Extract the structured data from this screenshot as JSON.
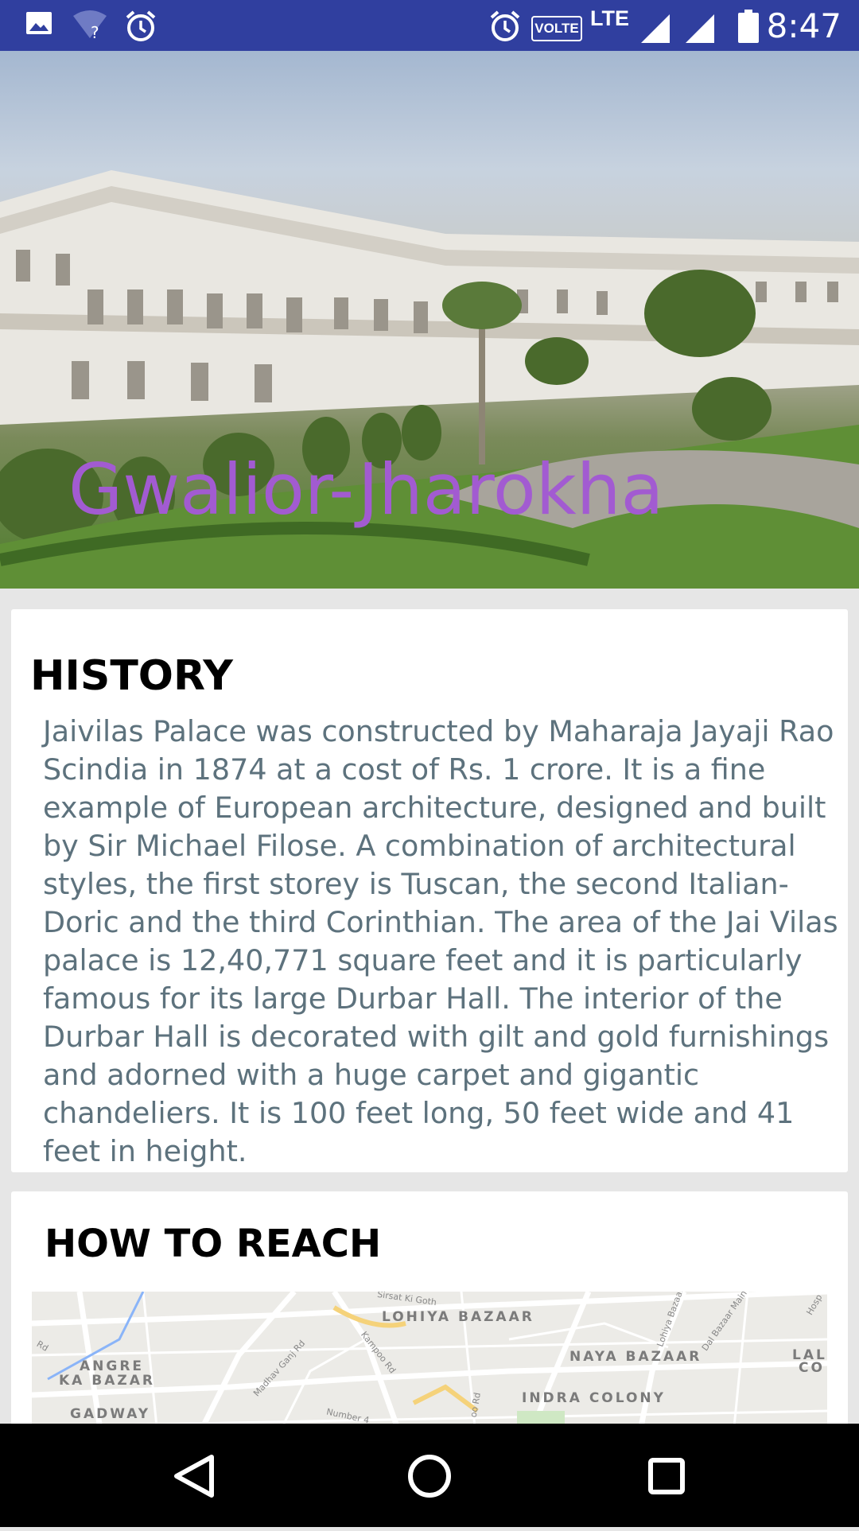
{
  "status_bar": {
    "time": "8:47",
    "network_badge": "VOLTE",
    "network_type": "LTE",
    "left_icons": [
      "image-icon",
      "wifi-unknown-icon",
      "alarm-icon"
    ],
    "right_icons": [
      "alarm-icon",
      "signal-icon",
      "signal-icon",
      "battery-icon"
    ]
  },
  "hero": {
    "title": "Gwalior-Jharokha"
  },
  "history": {
    "title": "HISTORY",
    "body": "Jaivilas Palace was constructed by Maharaja Jayaji Rao Scindia in 1874 at a cost of Rs. 1 crore. It is a fine example of European architecture, designed and built by Sir Michael Filose. A combination of architectural styles, the first storey is Tuscan, the second Italian-Doric and the third Corinthian. The area of the Jai Vilas palace is 12,40,771 square feet and it is particularly famous for its large Durbar Hall. The interior of the Durbar Hall is decorated with gilt and gold furnishings and adorned with a huge carpet and gigantic chandeliers. It is 100 feet long, 50 feet wide and 41 feet in height."
  },
  "how_to_reach": {
    "title": "HOW TO REACH",
    "map_labels": [
      "LOHIYA BAZAAR",
      "ANGRE",
      "KA BAZAR",
      "NAYA BAZAAR",
      "INDRA COLONY",
      "GADWAY",
      "LAL",
      "CO"
    ],
    "map_roads": [
      "Sirsat Ki Goth",
      "Madhav Ganj Rd",
      "Kampoo Rd",
      "Lohiya Bazaar",
      "Dal Bazaar Main",
      "Rd",
      "Number 4",
      "oo Rd",
      "Hosp"
    ]
  },
  "nav_bar": {
    "icons": [
      "back-icon",
      "home-icon",
      "recents-icon"
    ]
  },
  "colors": {
    "status_bar": "#303f9f",
    "hero_title": "#a25bd1",
    "body_text": "#5d727d",
    "background": "#e6e6e6"
  }
}
